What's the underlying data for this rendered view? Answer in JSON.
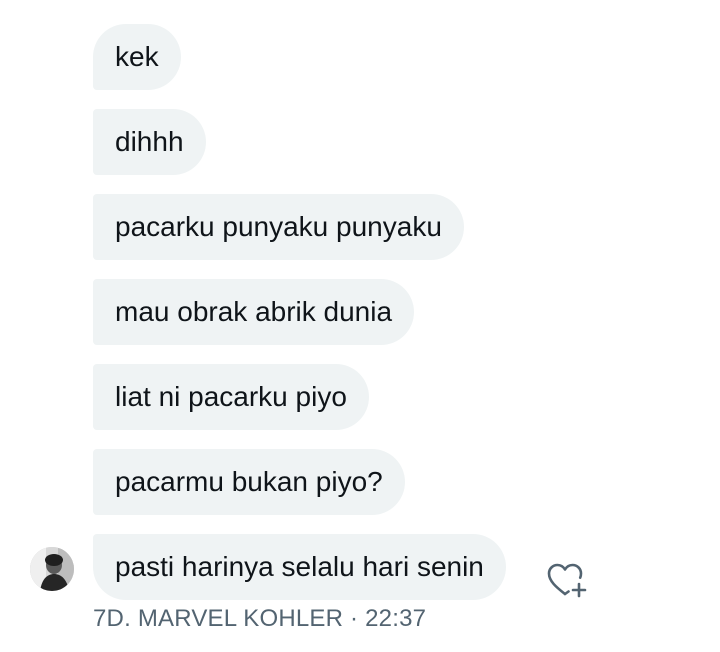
{
  "messages": [
    {
      "text": "kek"
    },
    {
      "text": "dihhh"
    },
    {
      "text": "pacarku punyaku punyaku"
    },
    {
      "text": "mau obrak abrik dunia"
    },
    {
      "text": "liat ni pacarku piyo"
    },
    {
      "text": "pacarmu bukan piyo?"
    },
    {
      "text": "pasti harinya selalu hari senin"
    }
  ],
  "footer": {
    "sender": "7D. MARVEL KOHLER",
    "separator": "·",
    "time": "22:37"
  },
  "icons": {
    "avatar": "sender-avatar",
    "reaction": "heart-plus-icon"
  },
  "colors": {
    "bubble": "#eff3f4",
    "text": "#0f1419",
    "meta": "#536471",
    "icon": "#536471"
  }
}
